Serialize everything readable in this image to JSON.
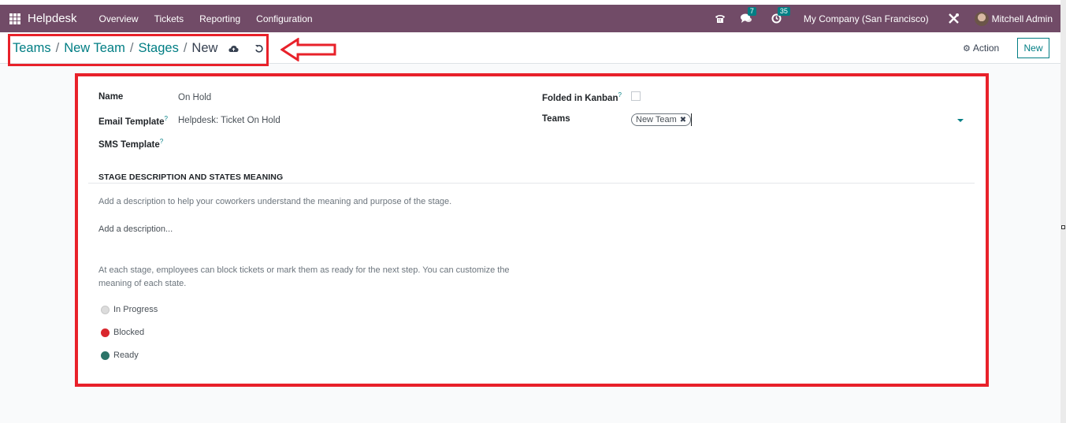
{
  "navbar": {
    "app_name": "Helpdesk",
    "menu": [
      "Overview",
      "Tickets",
      "Reporting",
      "Configuration"
    ],
    "messages_count": "7",
    "activities_count": "35",
    "company": "My Company (San Francisco)",
    "user": "Mitchell Admin"
  },
  "breadcrumb": {
    "items": [
      "Teams",
      "New Team",
      "Stages"
    ],
    "current": "New"
  },
  "control_panel": {
    "action_label": "Action",
    "new_label": "New"
  },
  "form": {
    "name_label": "Name",
    "name_value": "On Hold",
    "email_template_label": "Email Template",
    "email_template_value": "Helpdesk: Ticket On Hold",
    "sms_template_label": "SMS Template",
    "sms_template_value": "",
    "folded_label": "Folded in Kanban",
    "folded_checked": false,
    "teams_label": "Teams",
    "teams_tags": [
      "New Team"
    ],
    "help_mark": "?",
    "section_title": "STAGE DESCRIPTION AND STATES MEANING",
    "section_help": "Add a description to help your coworkers understand the meaning and purpose of the stage.",
    "description_placeholder": "Add a description...",
    "states_help": "At each stage, employees can block tickets or mark them as ready for the next step. You can customize the meaning of each state.",
    "states": [
      {
        "label": "In Progress",
        "color": "#dcdcdc"
      },
      {
        "label": "Blocked",
        "color": "#d9272e"
      },
      {
        "label": "Ready",
        "color": "#2b7468"
      }
    ]
  },
  "colors": {
    "navbar": "#714b67",
    "accent": "#017e84",
    "annotation": "#e8212a"
  }
}
